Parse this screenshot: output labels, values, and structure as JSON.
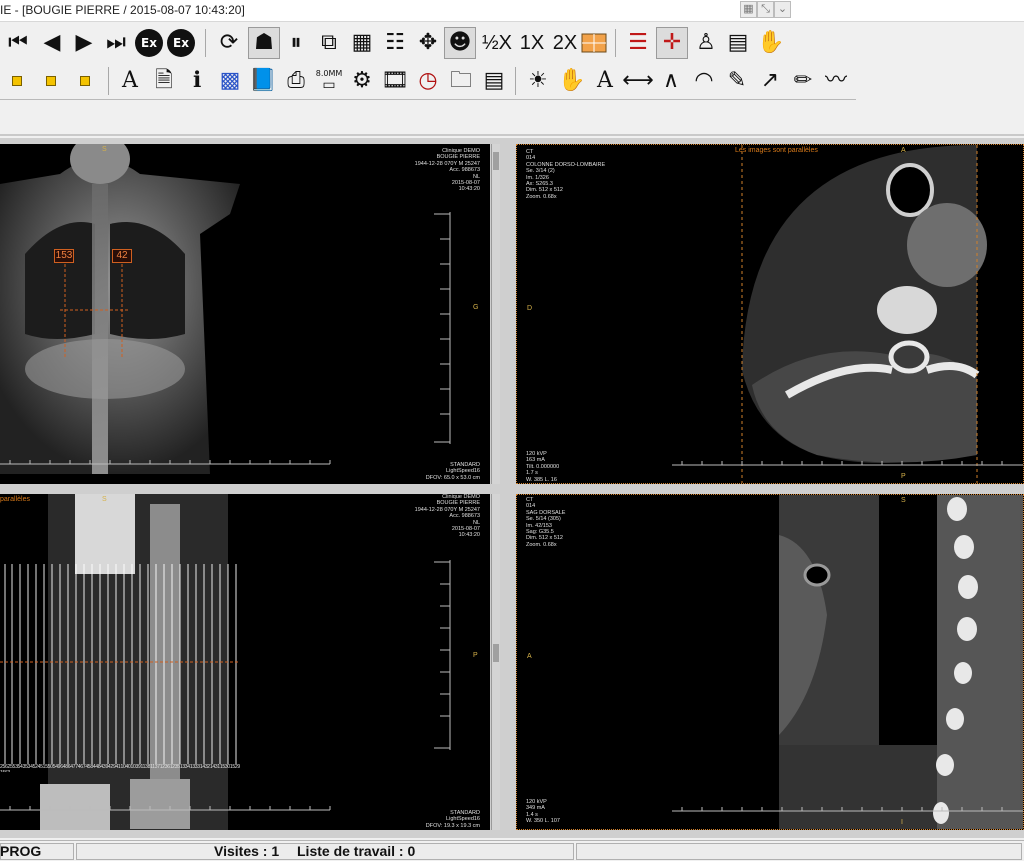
{
  "window": {
    "title": "IE - [BOUGIE PIERRE / 2015-08-07 10:43:20]",
    "controls": [
      "maximize-icon",
      "restore-icon",
      "chevron-down-icon"
    ]
  },
  "toolbar1": {
    "buttons": [
      {
        "name": "first-image-icon",
        "glyph": "⏮"
      },
      {
        "name": "prev-image-icon",
        "glyph": "◀"
      },
      {
        "name": "next-image-icon",
        "glyph": "▶"
      },
      {
        "name": "last-image-icon",
        "glyph": "⏭"
      },
      {
        "name": "ex-prev-icon",
        "glyph": "Ex"
      },
      {
        "name": "ex-next-icon",
        "glyph": "Ex"
      },
      {
        "name": "rotate-icon",
        "glyph": "⟳"
      },
      {
        "name": "single-body-icon",
        "glyph": "☗"
      },
      {
        "name": "pause-icon",
        "glyph": "⏸"
      },
      {
        "name": "split-view-icon",
        "glyph": "⧉"
      },
      {
        "name": "grid-layout-icon",
        "glyph": "▦"
      },
      {
        "name": "multi-patient-icon",
        "glyph": "☷"
      },
      {
        "name": "move-arrows-icon",
        "glyph": "✥"
      },
      {
        "name": "patient-icon",
        "glyph": "☻"
      }
    ],
    "zoom_half": "½X",
    "zoom_1x": "1X",
    "zoom_2x": "2X",
    "right_buttons": [
      "layout-grid-icon",
      "ruler-person-icon",
      "target-person-icon",
      "person-icon",
      "stack-icon",
      "hand-icon"
    ]
  },
  "toolbar2": {
    "left_buttons": [
      "marker-row-1-icon",
      "marker-row-2-icon",
      "marker-row-3-icon"
    ],
    "mid_buttons": [
      "text-tool-icon",
      "document-icon",
      "info-icon",
      "pixel-grid-icon",
      "book-icon",
      "print-icon",
      "scale-icon",
      "link-icon",
      "film-icon",
      "clock-icon",
      "folder-icon",
      "ruler-icon"
    ],
    "tools": [
      "brightness-icon",
      "hand-d-icon",
      "text-d-icon",
      "line-d-icon",
      "angle-d-icon",
      "protractor-icon",
      "pen-d-icon",
      "arrow-d-icon",
      "pencil-d-icon",
      "freehand-d-icon"
    ],
    "scale_label": "8.0MM"
  },
  "viewport1": {
    "info_right": "Clinique DEMO\nBOUGIE PIERRE\n1944-12-28 070Y M 25247\nAcc. 988673\nNL\n2015-08-07\n10:43:20",
    "info_bottom_right": "STANDARD\nLightSpeed16\nDFOV: 65.0 x 53.0 cm",
    "orient_top": "S",
    "orient_right": "G",
    "mark_left": "153",
    "mark_right": "42"
  },
  "viewport2": {
    "info_left": "CT\n014\nCOLONNE DORSO-LOMBAIRE\nSe. 3/14 (2)\nIm. 1/326\nAx: S265.3\nDim. 512 x 512\nZoom. 0.68x",
    "info_bottom_left": "120 kVP\n163 mA\nTilt. 0.000000\n1.7 s\nW. 385 L. 16",
    "orient_top": "A",
    "orient_left": "D",
    "orient_bottom": "P",
    "annotation": "Les images sont parallèles"
  },
  "viewport3": {
    "info_right": "Clinique DEMO\nBOUGIE PIERRE\n1944-12-28 070Y M 25247\nAcc. 988673\nNL\n2015-08-07\n10:43:20",
    "info_bottom_right": "STANDARD\nLightSpeed16\nDFOV: 19.3 x 19.3 cm",
    "orient_top": "S",
    "orient_right": "P",
    "annotation": "parallèles",
    "slice_numbers": "256 255 354 353 452 451 550 549 648 647 746 745 844 843 942 941 1040 1039 1138 1137 1236 1235 1334 1333 1432 1431 1530 1529 1563"
  },
  "viewport4": {
    "info_left": "CT\n014\nSAG DORSALE\nSe. 5/14 (305)\nIm. 42/153\nSag: G35.5\nDim. 512 x 512\nZoom. 0.68x",
    "info_bottom_left": "120 kVP\n349 mA\n1.4 s\nW. 350 L. 107",
    "orient_top": "S",
    "orient_left": "A",
    "orient_bottom": "I"
  },
  "status": {
    "mode": "PROG",
    "visits": "Visites : 1",
    "worklist": "Liste de travail : 0"
  },
  "colors": {
    "overlay_text": "#e0e0e0",
    "orientation": "#d6b24a",
    "annotation": "#d87a1a",
    "viewport_border": "#d0802a"
  }
}
